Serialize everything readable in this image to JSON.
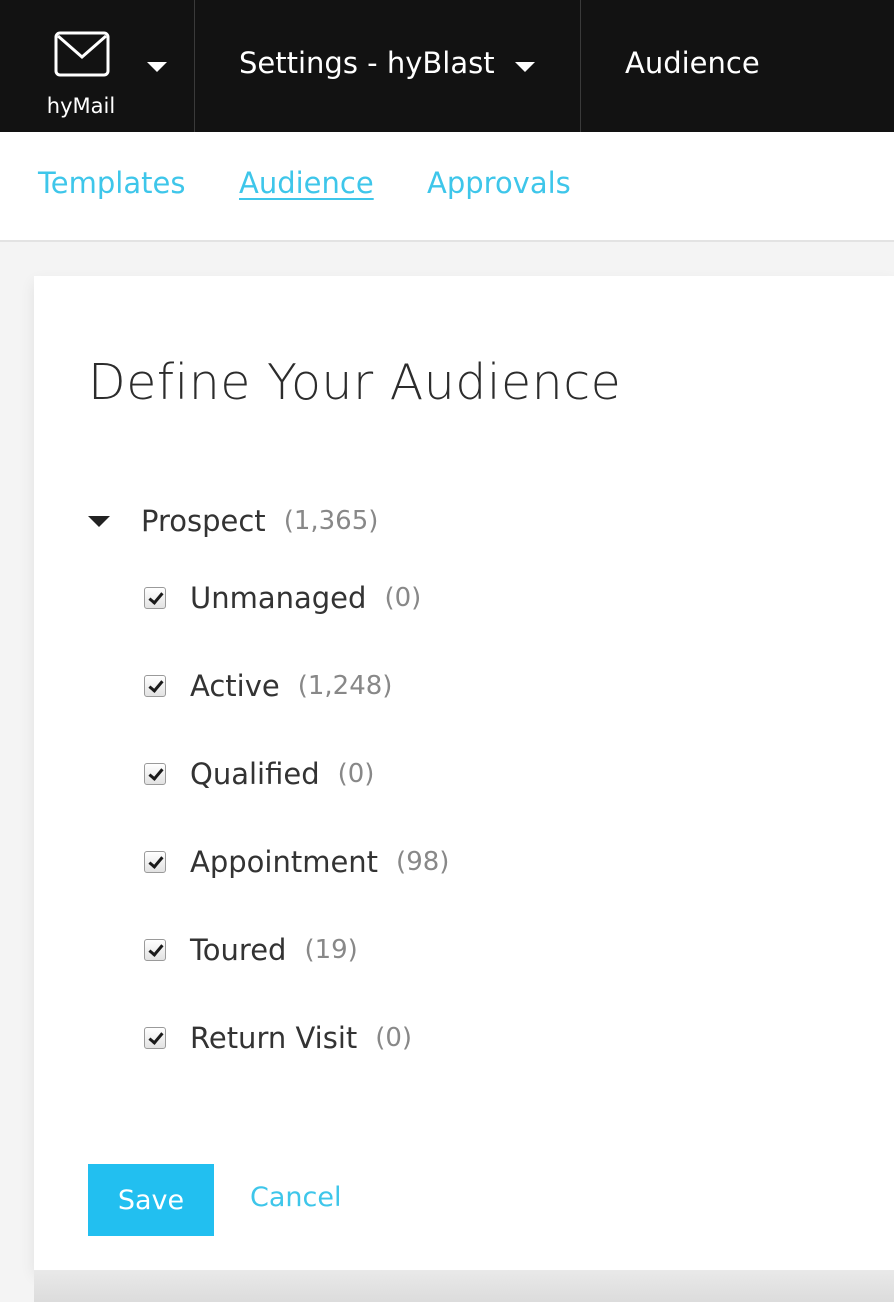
{
  "topbar": {
    "app_name": "hyMail",
    "app_icon": "mail-icon",
    "settings_label": "Settings - hyBlast",
    "current_page": "Audience"
  },
  "subnav": {
    "tabs": [
      {
        "label": "Templates",
        "active": false
      },
      {
        "label": "Audience",
        "active": true
      },
      {
        "label": "Approvals",
        "active": false
      }
    ]
  },
  "main": {
    "title": "Define Your Audience",
    "group": {
      "label": "Prospect",
      "count": "(1,365)",
      "expanded": true
    },
    "items": [
      {
        "label": "Unmanaged",
        "count": "(0)",
        "checked": true
      },
      {
        "label": "Active",
        "count": "(1,248)",
        "checked": true
      },
      {
        "label": "Qualified",
        "count": "(0)",
        "checked": true
      },
      {
        "label": "Appointment",
        "count": "(98)",
        "checked": true
      },
      {
        "label": "Toured",
        "count": "(19)",
        "checked": true
      },
      {
        "label": "Return Visit",
        "count": "(0)",
        "checked": true
      }
    ],
    "save_label": "Save",
    "cancel_label": "Cancel"
  },
  "colors": {
    "topbar_bg": "#121212",
    "link": "#3ec6ea",
    "primary_button": "#22bff0"
  }
}
